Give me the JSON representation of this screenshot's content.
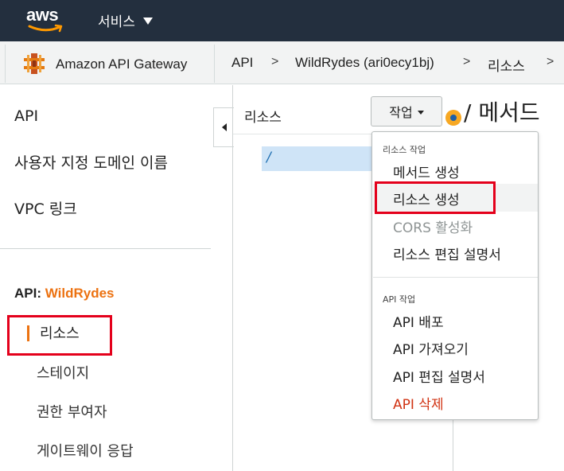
{
  "topbar": {
    "logo_text": "aws",
    "services_label": "서비스"
  },
  "breadcrumb": {
    "service_name": "Amazon API Gateway",
    "items": [
      "API",
      "WildRydes (ari0ecy1bj)",
      "리소스"
    ],
    "separator": ">"
  },
  "leftnav": {
    "top_items": [
      "API",
      "사용자 지정 도메인 이름",
      "VPC 링크"
    ],
    "api_prefix": "API:",
    "api_name": "WildRydes",
    "sub_items": [
      "리소스",
      "스테이지",
      "권한 부여자",
      "게이트웨이 응답"
    ],
    "active_sub_item": "리소스"
  },
  "resources": {
    "title": "리소스",
    "actions_label": "작업",
    "root_path": "/"
  },
  "methods": {
    "title": "/ 메서드"
  },
  "actions_menu": {
    "resource_heading": "리소스 작업",
    "resource_items": [
      "메서드 생성",
      "리소스 생성",
      "CORS 활성화",
      "리소스 편집 설명서"
    ],
    "api_heading": "API 작업",
    "api_items": [
      "API 배포",
      "API 가져오기",
      "API 편집 설명서",
      "API 삭제"
    ],
    "highlighted_item": "리소스 생성",
    "disabled_item": "CORS 활성화",
    "danger_item": "API 삭제"
  },
  "colors": {
    "topbar_bg": "#232f3e",
    "accent_orange": "#ec7211",
    "highlight_red": "#e4001b",
    "selected_blue": "#cfe4f7",
    "danger": "#d13212"
  },
  "icons": {
    "aws_logo": "aws-smile-logo",
    "services_caret": "caret-down-icon",
    "service_icon": "api-gateway-icon",
    "collapse": "chevron-left-icon",
    "method_status": "method-status-dot-icon"
  }
}
